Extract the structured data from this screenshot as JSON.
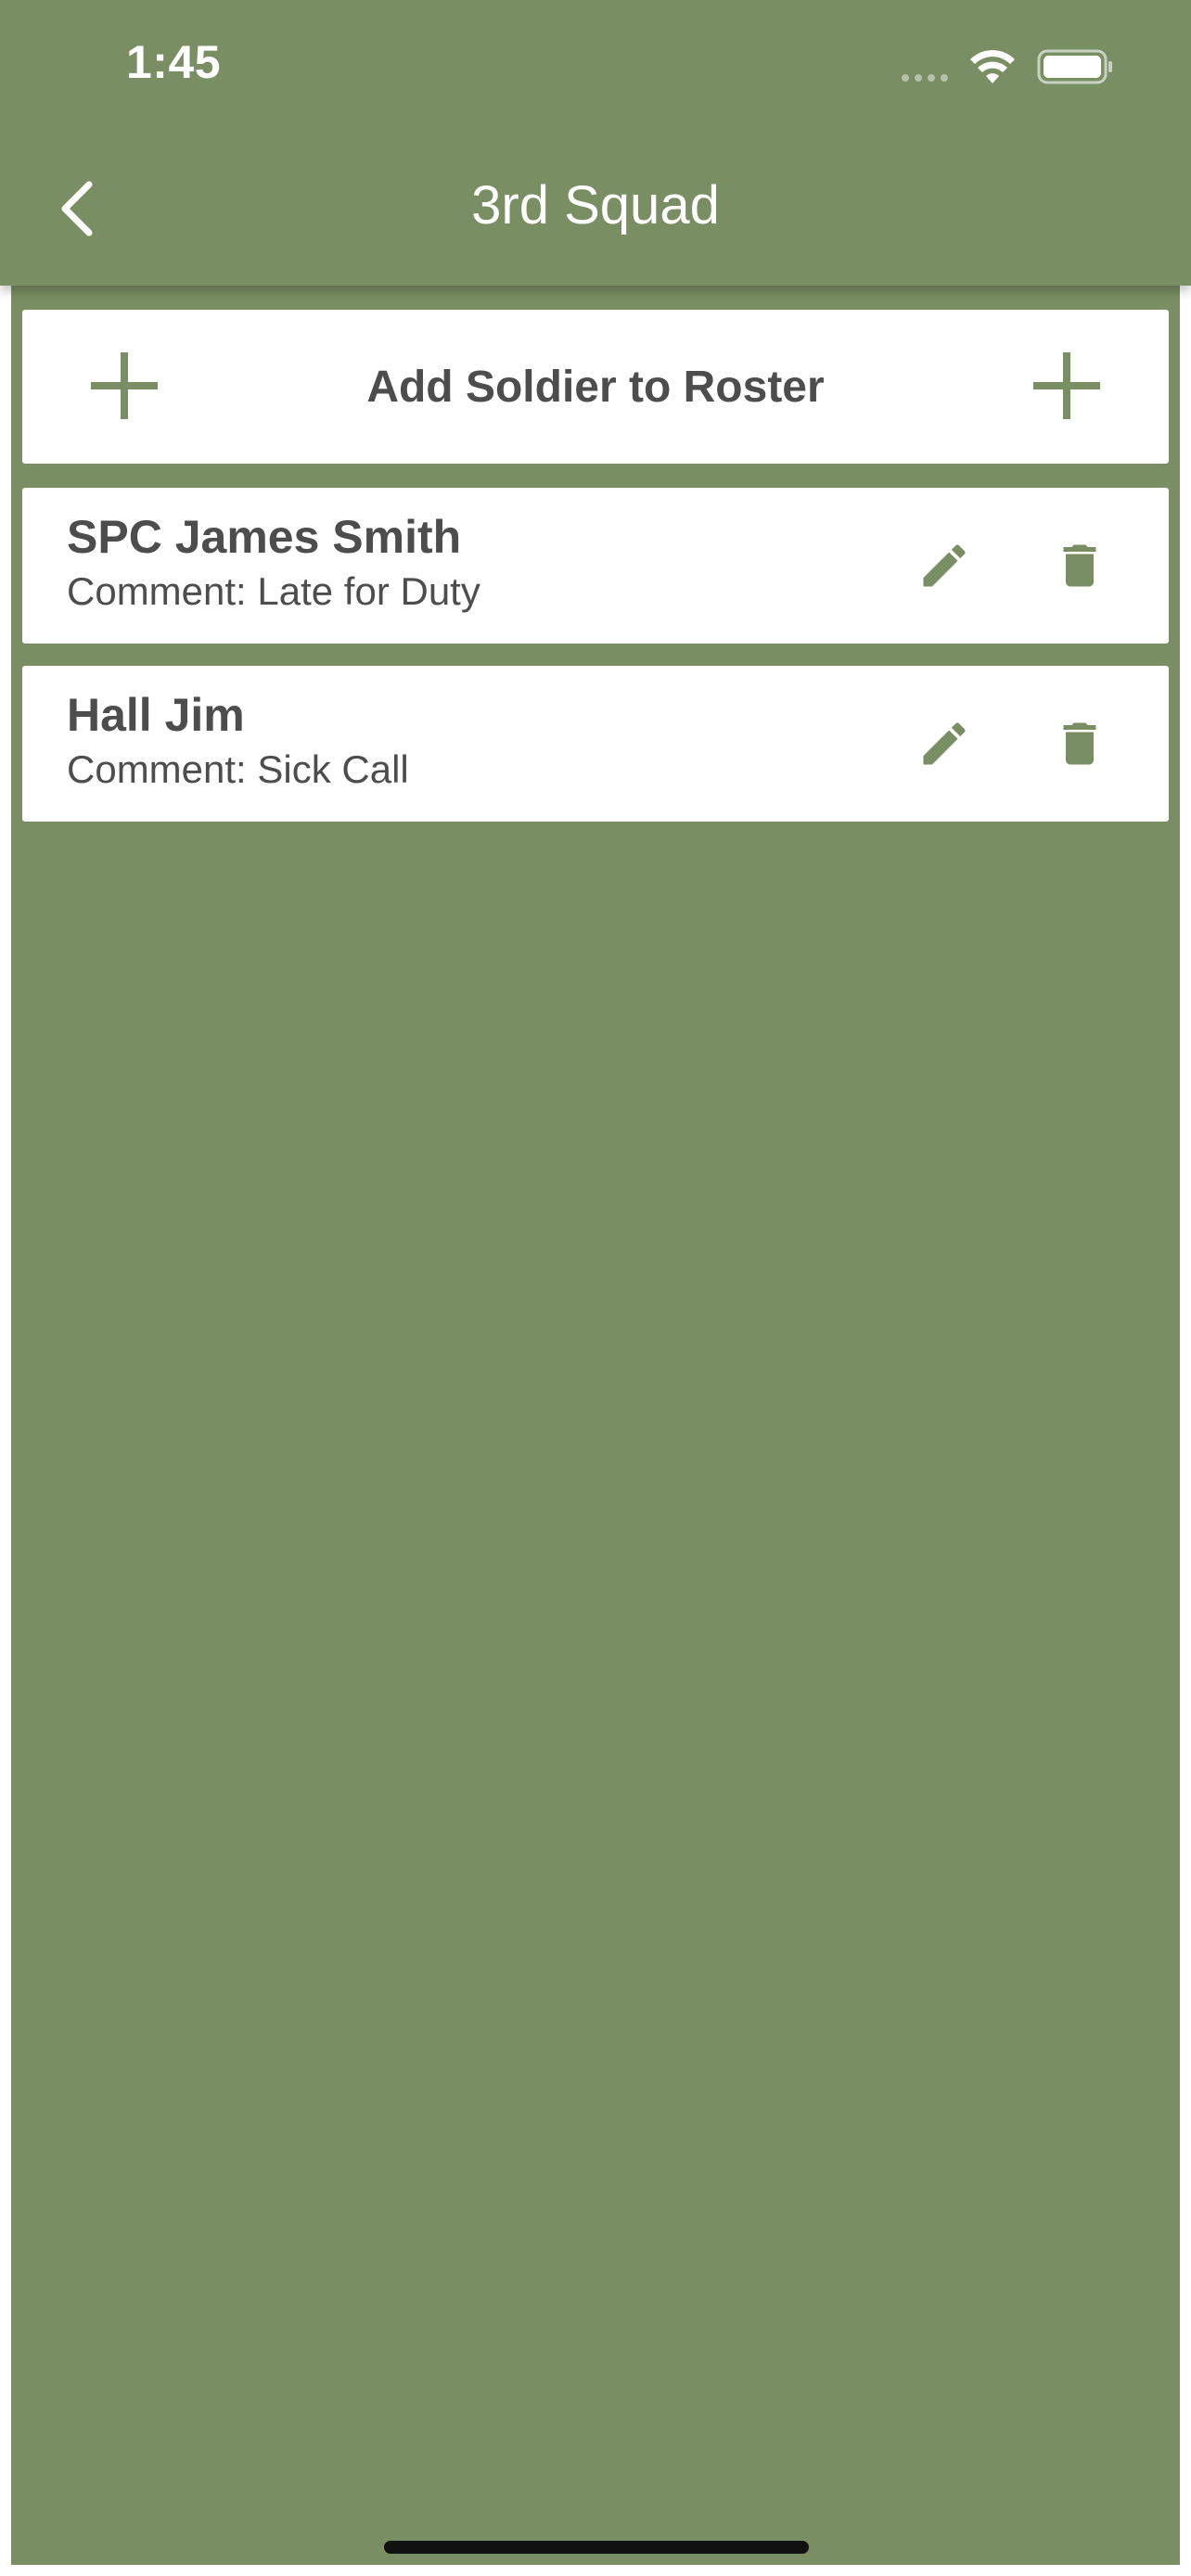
{
  "status_bar": {
    "time": "1:45",
    "icons": [
      "signal-dots-icon",
      "wifi-icon",
      "battery-icon"
    ]
  },
  "nav": {
    "title": "3rd Squad",
    "back_icon": "chevron-left-icon"
  },
  "roster": {
    "add_label": "Add Soldier to Roster",
    "add_icon": "plus-icon",
    "soldiers": [
      {
        "name": "SPC James Smith",
        "comment": "Comment: Late for Duty"
      },
      {
        "name": "Hall Jim",
        "comment": "Comment: Sick Call"
      }
    ],
    "row_icons": [
      "pencil-icon",
      "trash-icon"
    ]
  },
  "colors": {
    "primary": "#798e62",
    "card": "#ffffff",
    "text": "#4d4d4d"
  }
}
